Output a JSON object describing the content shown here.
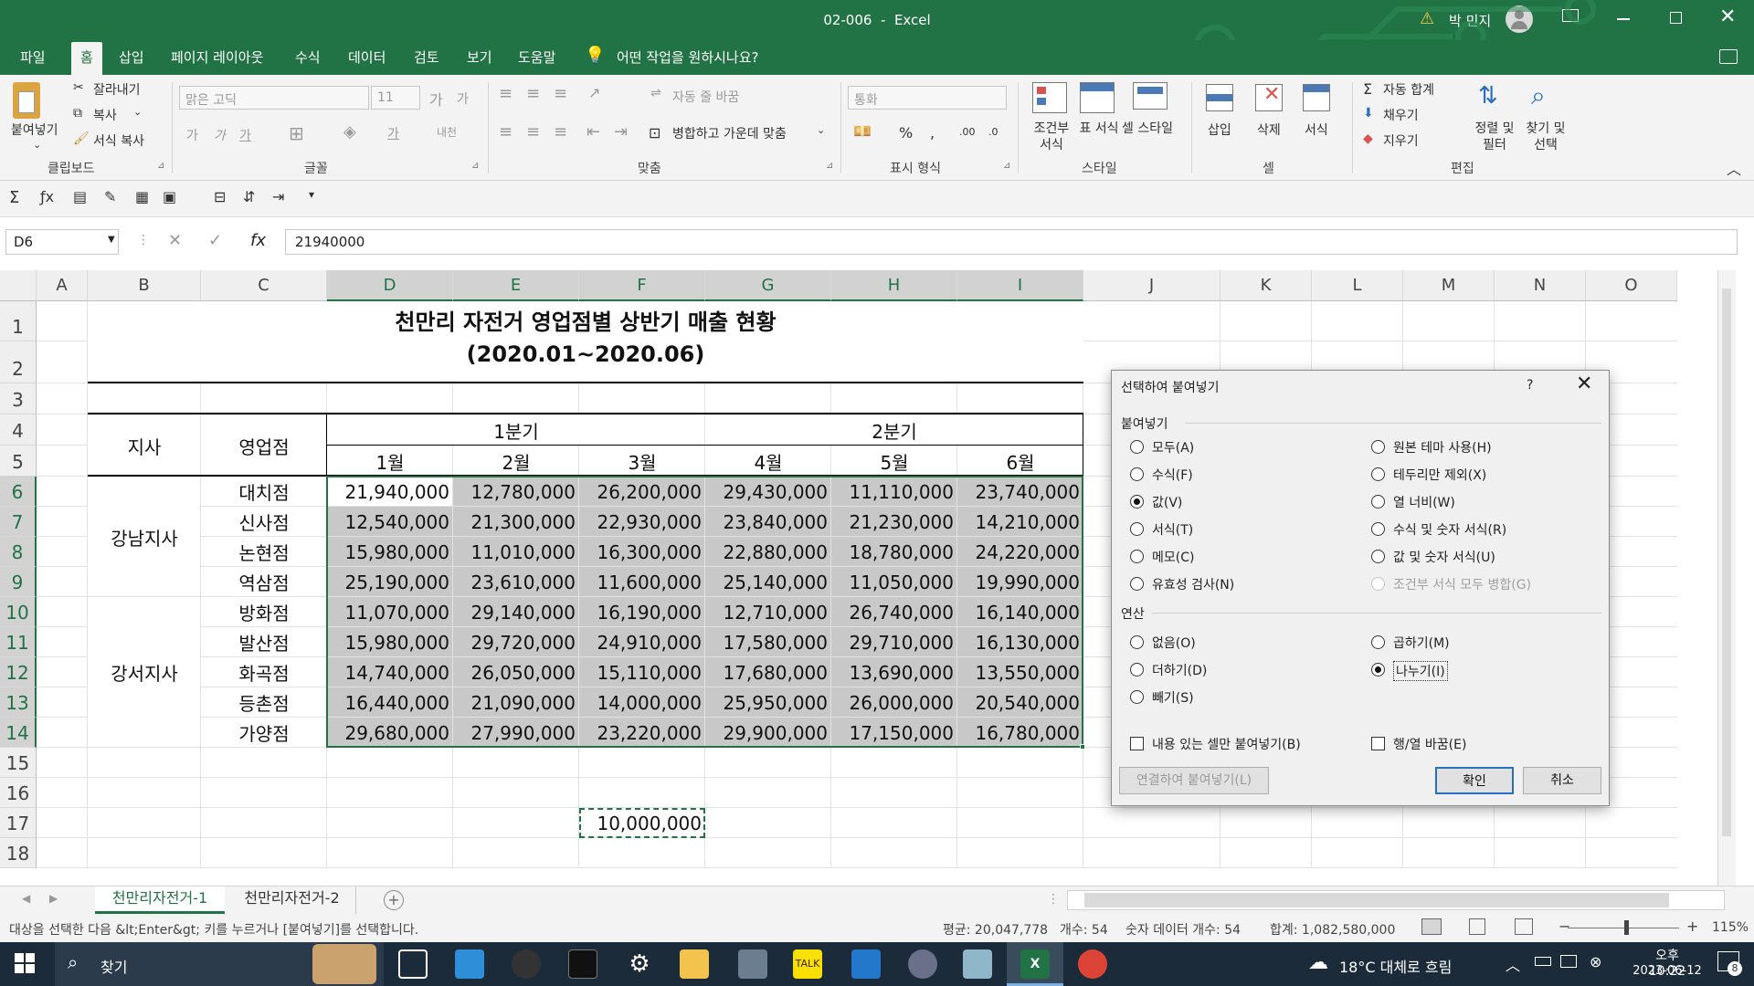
{
  "window": {
    "doc_title": "02-006",
    "app": "Excel",
    "user": "박 민지"
  },
  "menu": {
    "tabs": [
      "파일",
      "홈",
      "삽입",
      "페이지 레이아웃",
      "수식",
      "데이터",
      "검토",
      "보기",
      "도움말"
    ],
    "active": "홈",
    "tell_me": "어떤 작업을 원하시나요?"
  },
  "ribbon": {
    "clipboard": {
      "paste": "붙여넣기",
      "cut": "잘라내기",
      "copy": "복사",
      "format_painter": "서식 복사",
      "label": "클립보드"
    },
    "font": {
      "name": "맑은 고딕",
      "size": "11",
      "label": "글꼴"
    },
    "align": {
      "wrap": "자동 줄 바꿈",
      "merge": "병합하고 가운데 맞춤",
      "label": "맞춤"
    },
    "number": {
      "format": "통화",
      "label": "표시 형식"
    },
    "styles": {
      "cond": "조건부 서식",
      "table": "표 서식",
      "cell": "셀 스타일",
      "label": "스타일"
    },
    "cells": {
      "insert": "삽입",
      "delete": "삭제",
      "format": "서식",
      "label": "셀"
    },
    "editing": {
      "autosum": "자동 합계",
      "fill": "채우기",
      "clear": "지우기",
      "sort": "정렬 및 필터",
      "find": "찾기 및 선택",
      "label": "편집"
    }
  },
  "formula_bar": {
    "name_box": "D6",
    "value": "21940000"
  },
  "columns": [
    "A",
    "B",
    "C",
    "D",
    "E",
    "F",
    "G",
    "H",
    "I",
    "J",
    "K",
    "L",
    "M",
    "N",
    "O"
  ],
  "rows": [
    "1",
    "2",
    "3",
    "4",
    "5",
    "6",
    "7",
    "8",
    "9",
    "10",
    "11",
    "12",
    "13",
    "14",
    "15",
    "16",
    "17",
    "18"
  ],
  "sheet": {
    "title": "천만리 자전거 영업점별 상반기 매출 현황",
    "subtitle": "(2020.01~2020.06)",
    "hdr_branch": "지사",
    "hdr_store": "영업점",
    "q1": "1분기",
    "q2": "2분기",
    "months": [
      "1월",
      "2월",
      "3월",
      "4월",
      "5월",
      "6월"
    ],
    "gangnam": "강남지사",
    "gangseo": "강서지사",
    "stores": [
      "대치점",
      "신사점",
      "논현점",
      "역삼점",
      "방화점",
      "발산점",
      "화곡점",
      "등촌점",
      "가양점"
    ],
    "values": [
      [
        "21,940,000",
        "12,780,000",
        "26,200,000",
        "29,430,000",
        "11,110,000",
        "23,740,000"
      ],
      [
        "12,540,000",
        "21,300,000",
        "22,930,000",
        "23,840,000",
        "21,230,000",
        "14,210,000"
      ],
      [
        "15,980,000",
        "11,010,000",
        "16,300,000",
        "22,880,000",
        "18,780,000",
        "24,220,000"
      ],
      [
        "25,190,000",
        "23,610,000",
        "11,600,000",
        "25,140,000",
        "11,050,000",
        "19,990,000"
      ],
      [
        "11,070,000",
        "29,140,000",
        "16,190,000",
        "12,710,000",
        "26,740,000",
        "16,140,000"
      ],
      [
        "15,980,000",
        "29,720,000",
        "24,910,000",
        "17,580,000",
        "29,710,000",
        "16,130,000"
      ],
      [
        "14,740,000",
        "26,050,000",
        "15,110,000",
        "17,680,000",
        "13,690,000",
        "13,550,000"
      ],
      [
        "16,440,000",
        "21,090,000",
        "14,000,000",
        "25,950,000",
        "26,000,000",
        "20,540,000"
      ],
      [
        "29,680,000",
        "27,990,000",
        "23,220,000",
        "29,900,000",
        "17,150,000",
        "16,780,000"
      ]
    ],
    "copied": "10,000,000"
  },
  "dialog": {
    "title": "선택하여 붙여넣기",
    "help": "?",
    "paste_label": "붙여넣기",
    "paste_left": [
      "모두(A)",
      "수식(F)",
      "값(V)",
      "서식(T)",
      "메모(C)",
      "유효성 검사(N)"
    ],
    "paste_right": [
      "원본 테마 사용(H)",
      "테두리만 제외(X)",
      "열 너비(W)",
      "수식 및 숫자 서식(R)",
      "값 및 숫자 서식(U)",
      "조건부 서식 모두 병합(G)"
    ],
    "op_label": "연산",
    "op_left": [
      "없음(O)",
      "더하기(D)",
      "빼기(S)"
    ],
    "op_right": [
      "곱하기(M)",
      "나누기(I)"
    ],
    "skip_blanks": "내용 있는 셀만 붙여넣기(B)",
    "transpose": "행/열 바꿈(E)",
    "paste_link": "연결하여 붙여넣기(L)",
    "ok": "확인",
    "cancel": "취소"
  },
  "sheet_tabs": [
    "천만리자전거-1",
    "천만리자전거-2"
  ],
  "status": {
    "message": "대상을 선택한 다음 &lt;Enter&gt; 키를 누르거나 [붙여넣기]를 선택합니다.",
    "average": "평균: 20,047,778",
    "count": "개수: 54",
    "num_count": "숫자 데이터 개수: 54",
    "sum": "합계: 1,082,580,000",
    "zoom": "115%"
  },
  "taskbar": {
    "search": "찾기",
    "weather": "18°C 대체로 흐림",
    "time": "오후 10:22",
    "date": "2023-06-12",
    "badge": "8"
  },
  "colors": {
    "excel_green": "#217346",
    "selection_fill": "#c8c8c8",
    "taskbar": "#1c2b39"
  }
}
